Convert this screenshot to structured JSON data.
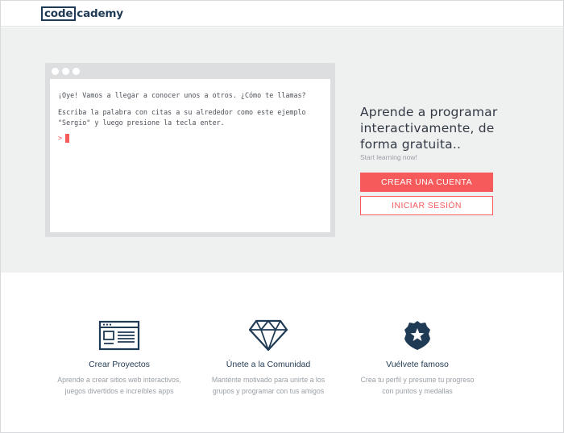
{
  "header": {
    "logo_boxed": "code",
    "logo_rest": "cademy"
  },
  "terminal": {
    "question": "¡Oye! Vamos a llegar a conocer unos a otros. ¿Cómo te llamas?",
    "instruction_line1": "Escriba la palabra con citas a su alrededor como este ejemplo",
    "instruction_line2": "\"Sergio\" y luego presione la tecla enter.",
    "prompt_symbol": ">"
  },
  "pitch": {
    "headline": "Aprende a programar interactivamente, de forma gratuita..",
    "subline": "Start learning now!",
    "primary_button": "CREAR UNA CUENTA",
    "secondary_button": "INICIAR SESIÓN"
  },
  "features": [
    {
      "icon": "browser-window-icon",
      "title": "Crear Proyectos",
      "desc": "Aprende a crear sitios web interactivos, juegos divertidos e increíbles apps"
    },
    {
      "icon": "diamond-icon",
      "title": "Únete a la Comunidad",
      "desc": "Manténte motivado para unirte a los grupos y programar con tus amigos"
    },
    {
      "icon": "badge-star-icon",
      "title": "Vuélvete famoso",
      "desc": "Crea tu perfil y presume tu progreso con puntos y medallas"
    }
  ],
  "colors": {
    "brand": "#1f3a54",
    "accent": "#f65a5b",
    "hero_bg": "#eff0f0",
    "muted_text": "#9aa0a6"
  }
}
